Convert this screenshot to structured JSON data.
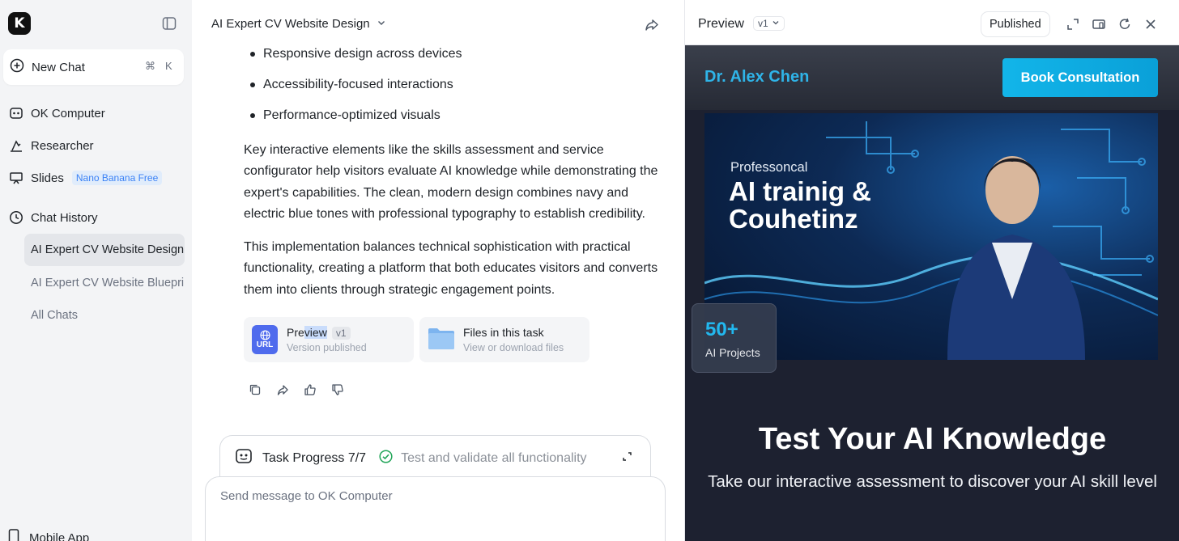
{
  "sidebar": {
    "logo_letter": "K",
    "new_chat": {
      "label": "New Chat",
      "shortcut_cmd": "⌘",
      "shortcut_key": "K"
    },
    "nav": [
      {
        "label": "OK Computer",
        "icon": "robot-icon"
      },
      {
        "label": "Researcher",
        "icon": "researcher-icon"
      },
      {
        "label": "Slides",
        "icon": "slides-icon",
        "badge": "Nano Banana Free"
      },
      {
        "label": "Chat History",
        "icon": "clock-icon"
      }
    ],
    "history": [
      {
        "label": "AI Expert CV Website Design",
        "active": true
      },
      {
        "label": "AI Expert CV Website Blueprint",
        "active": false
      },
      {
        "label": "All Chats",
        "active": false
      }
    ],
    "mobile_app": "Mobile App"
  },
  "chat": {
    "title": "AI Expert CV Website Design",
    "bullets": [
      "Responsive design across devices",
      "Accessibility-focused interactions",
      "Performance-optimized visuals"
    ],
    "paragraphs": [
      "Key interactive elements like the skills assessment and service configurator help visitors evaluate AI knowledge while demonstrating the expert's capabilities. The clean, modern design combines navy and electric blue tones with professional typography to establish credibility.",
      "This implementation balances technical sophistication with practical functionality, creating a platform that both educates visitors and converts them into clients through strategic engagement points."
    ],
    "preview_card": {
      "title_pre": "Pre",
      "title_sel": "view",
      "version": "v1",
      "subtitle": "Version published",
      "icon_text": "URL"
    },
    "files_card": {
      "title": "Files in this task",
      "subtitle": "View or download files"
    },
    "task": {
      "label": "Task Progress 7/7",
      "step": "Test and validate all functionality"
    },
    "composer": {
      "placeholder": "Send message to OK Computer"
    }
  },
  "preview": {
    "title": "Preview",
    "version": "v1",
    "published_label": "Published",
    "site": {
      "brand": "Dr. Alex Chen",
      "cta": "Book Consultation",
      "hero_small": "Professoncal",
      "hero_big_line1": "AI trainig &",
      "hero_big_line2": "Couhetinz",
      "stat_number": "50+",
      "stat_label": "AI Projects",
      "section_title": "Test Your AI Knowledge",
      "section_sub": "Take our interactive assessment to discover your AI skill level"
    }
  },
  "colors": {
    "accent": "#12b5e9",
    "brand_text": "#2fb4e8",
    "site_bg": "#1d2130",
    "badge_bg": "#e0ecfb",
    "badge_text": "#3b82f6"
  }
}
